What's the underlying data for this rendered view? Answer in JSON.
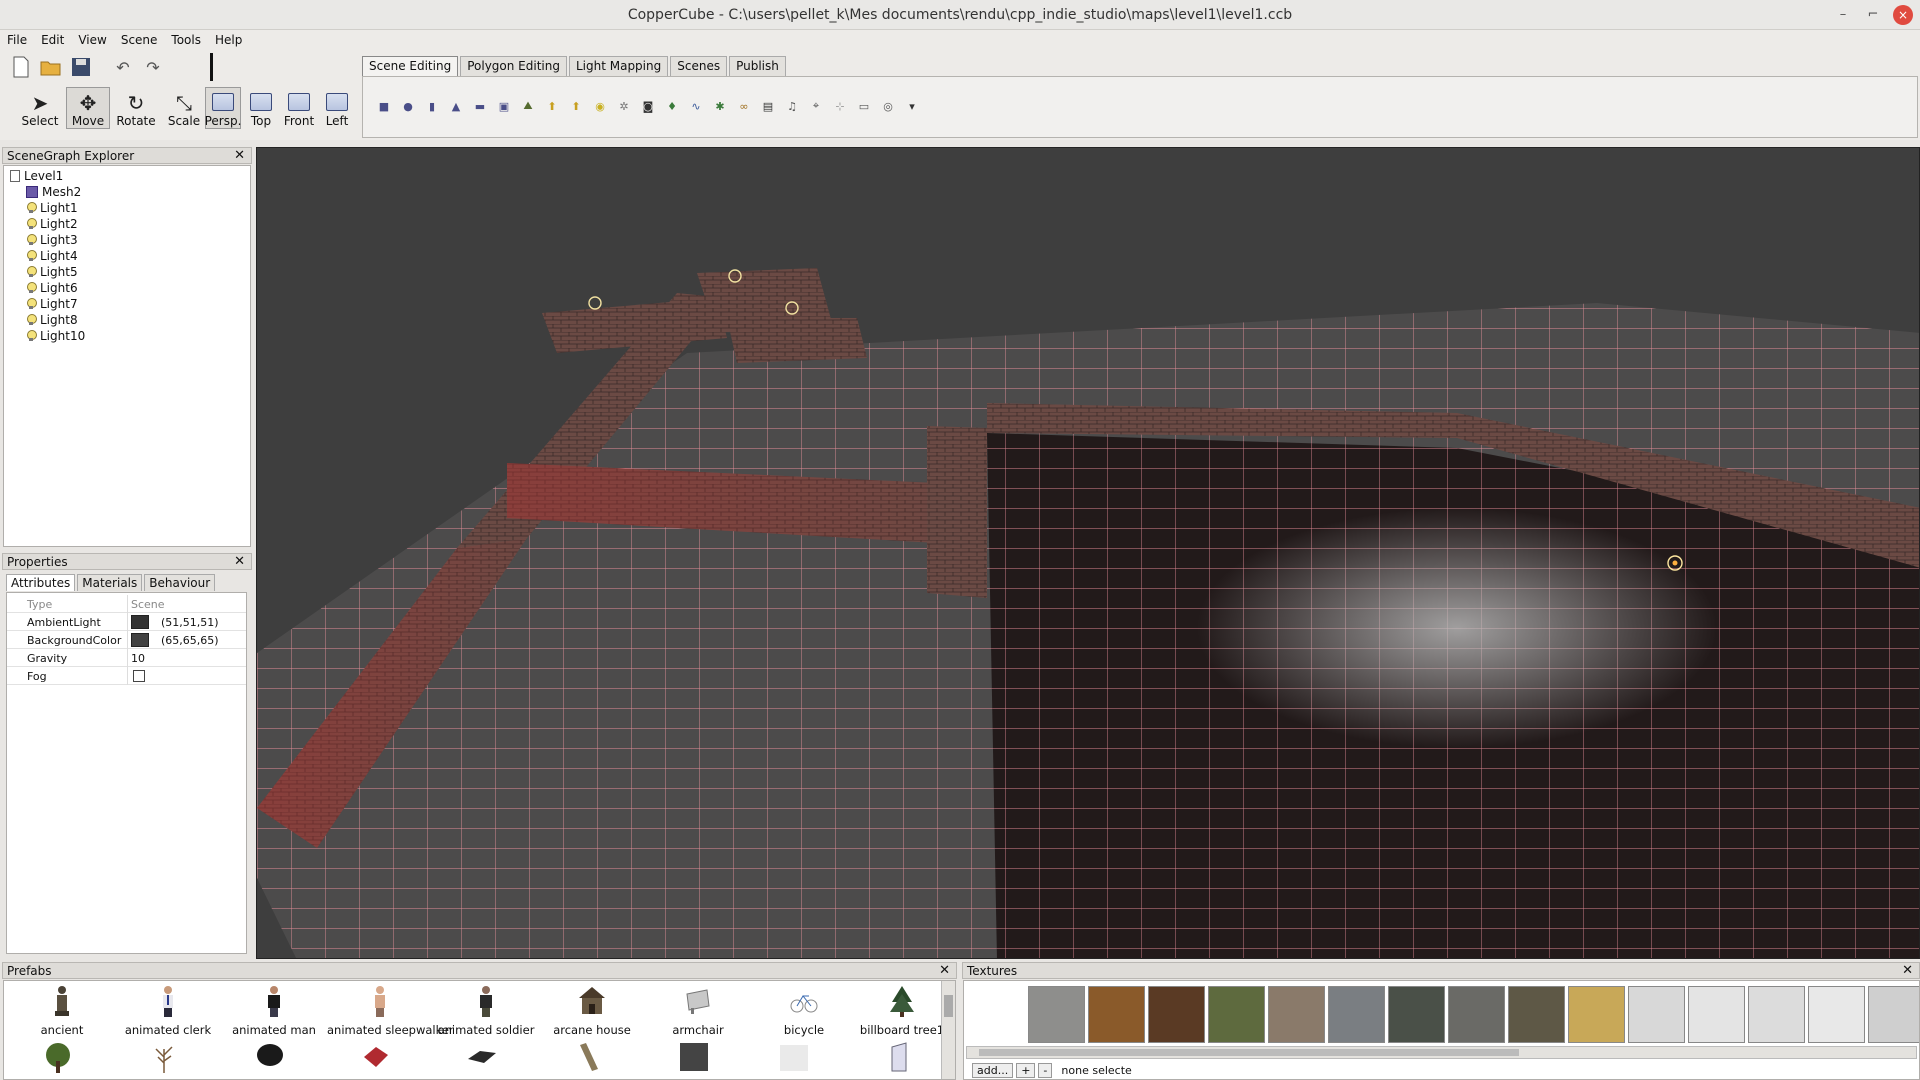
{
  "window": {
    "title": "CopperCube - C:\\users\\pellet_k\\Mes documents\\rendu\\cpp_indie_studio\\maps\\level1\\level1.ccb",
    "minimize_glyph": "–",
    "maximize_glyph": "⌐",
    "close_glyph": "×"
  },
  "menu": [
    "File",
    "Edit",
    "View",
    "Scene",
    "Tools",
    "Help"
  ],
  "toolbar": {
    "file_icons": [
      "new-icon",
      "open-icon",
      "save-icon",
      "undo-icon",
      "redo-icon"
    ],
    "modes": [
      {
        "label": "Select",
        "icon": "cursor-icon",
        "glyph": "➤"
      },
      {
        "label": "Move",
        "icon": "move-arrows-icon",
        "glyph": "✥"
      },
      {
        "label": "Rotate",
        "icon": "rotate-icon",
        "glyph": "↻"
      },
      {
        "label": "Scale",
        "icon": "scale-icon",
        "glyph": "⤡"
      }
    ],
    "views": [
      {
        "label": "Persp.",
        "icon": "perspective-view-icon"
      },
      {
        "label": "Top",
        "icon": "top-view-icon"
      },
      {
        "label": "Front",
        "icon": "front-view-icon"
      },
      {
        "label": "Left",
        "icon": "left-view-icon"
      }
    ]
  },
  "main_tabs": [
    "Scene Editing",
    "Polygon Editing",
    "Light Mapping",
    "Scenes",
    "Publish"
  ],
  "scene_tool_icons": [
    {
      "name": "cube-icon",
      "glyph": "■",
      "color": "#4a4e88"
    },
    {
      "name": "sphere-icon",
      "glyph": "●",
      "color": "#4a4e88"
    },
    {
      "name": "cylinder-icon",
      "glyph": "▮",
      "color": "#4a4e88"
    },
    {
      "name": "cone-icon",
      "glyph": "▲",
      "color": "#4a4e88"
    },
    {
      "name": "plane-icon",
      "glyph": "▬",
      "color": "#4a4e88"
    },
    {
      "name": "skybox-icon",
      "glyph": "▣",
      "color": "#4a4e88"
    },
    {
      "name": "terrain-icon",
      "glyph": "⛰",
      "color": "#556b2f"
    },
    {
      "name": "import-mesh-icon",
      "glyph": "⬆",
      "color": "#c8a020"
    },
    {
      "name": "import-animated-icon",
      "glyph": "⬆",
      "color": "#c8a020"
    },
    {
      "name": "light-icon",
      "glyph": "◉",
      "color": "#c8b020"
    },
    {
      "name": "particle-icon",
      "glyph": "✲",
      "color": "#777"
    },
    {
      "name": "camera-icon",
      "glyph": "◙",
      "color": "#333"
    },
    {
      "name": "billboard-icon",
      "glyph": "♦",
      "color": "#3a7a3a"
    },
    {
      "name": "water-icon",
      "glyph": "∿",
      "color": "#3a5a9a"
    },
    {
      "name": "tree-icon",
      "glyph": "✱",
      "color": "#3a7a3a"
    },
    {
      "name": "path-icon",
      "glyph": "∞",
      "color": "#a07020"
    },
    {
      "name": "overlay-2d-icon",
      "glyph": "▤",
      "color": "#333"
    },
    {
      "name": "sound-icon",
      "glyph": "♫",
      "color": "#555"
    },
    {
      "name": "waypoint-icon",
      "glyph": "⌖",
      "color": "#555"
    },
    {
      "name": "grid-icon",
      "glyph": "⊹",
      "color": "#999"
    },
    {
      "name": "text-icon",
      "glyph": "▭",
      "color": "#555"
    },
    {
      "name": "game-ai-icon",
      "glyph": "◎",
      "color": "#555"
    },
    {
      "name": "more-dropdown-icon",
      "glyph": "▾",
      "color": "#333"
    }
  ],
  "scenegraph": {
    "title": "SceneGraph Explorer",
    "root": "Level1",
    "items": [
      {
        "label": "Mesh2",
        "type": "mesh"
      },
      {
        "label": "Light1",
        "type": "light"
      },
      {
        "label": "Light2",
        "type": "light"
      },
      {
        "label": "Light3",
        "type": "light"
      },
      {
        "label": "Light4",
        "type": "light"
      },
      {
        "label": "Light5",
        "type": "light"
      },
      {
        "label": "Light6",
        "type": "light"
      },
      {
        "label": "Light7",
        "type": "light"
      },
      {
        "label": "Light8",
        "type": "light"
      },
      {
        "label": "Light10",
        "type": "light"
      }
    ]
  },
  "properties": {
    "title": "Properties",
    "tabs": [
      "Attributes",
      "Materials",
      "Behaviour"
    ],
    "rows": [
      {
        "key": "Type",
        "value": "Scene",
        "kind": "header"
      },
      {
        "key": "AmbientLight",
        "value": "(51,51,51)",
        "kind": "color",
        "color": "#333333"
      },
      {
        "key": "BackgroundColor",
        "value": "(65,65,65)",
        "kind": "color",
        "color": "#414141"
      },
      {
        "key": "Gravity",
        "value": "10",
        "kind": "text"
      },
      {
        "key": "Fog",
        "value": "",
        "kind": "check"
      }
    ]
  },
  "prefabs": {
    "title": "Prefabs",
    "row1": [
      "ancient",
      "animated clerk",
      "animated man",
      "animated sleepwalker",
      "animated soldier",
      "arcane house",
      "armchair",
      "bicycle",
      "billboard tree1"
    ],
    "row2_icons": [
      "tree-icon",
      "bare-tree-icon",
      "smoke-icon",
      "red-cushion-icon",
      "dark-slab-icon",
      "plank-icon",
      "dark-panel-icon",
      "white-panel-icon",
      "door-icon"
    ]
  },
  "textures": {
    "title": "Textures",
    "add_label": "add...",
    "plus_label": "+",
    "minus_label": "-",
    "selection": "none selecte",
    "swatches": [
      "#8e8e8c",
      "#8a5a2a",
      "#5a3a24",
      "#5e6a3e",
      "#8a7a6a",
      "#7a7e82",
      "#4a5048",
      "#6a6a66",
      "#5e5846",
      "#c8a858",
      "#d8d8d8",
      "#e4e4e4",
      "#dcdcdc",
      "#e8e8e8",
      "#cfcfcf"
    ]
  },
  "viewport": {
    "background": "#414141",
    "grid_color": "#ff9aa8",
    "brick_color": "#6b4a44"
  }
}
